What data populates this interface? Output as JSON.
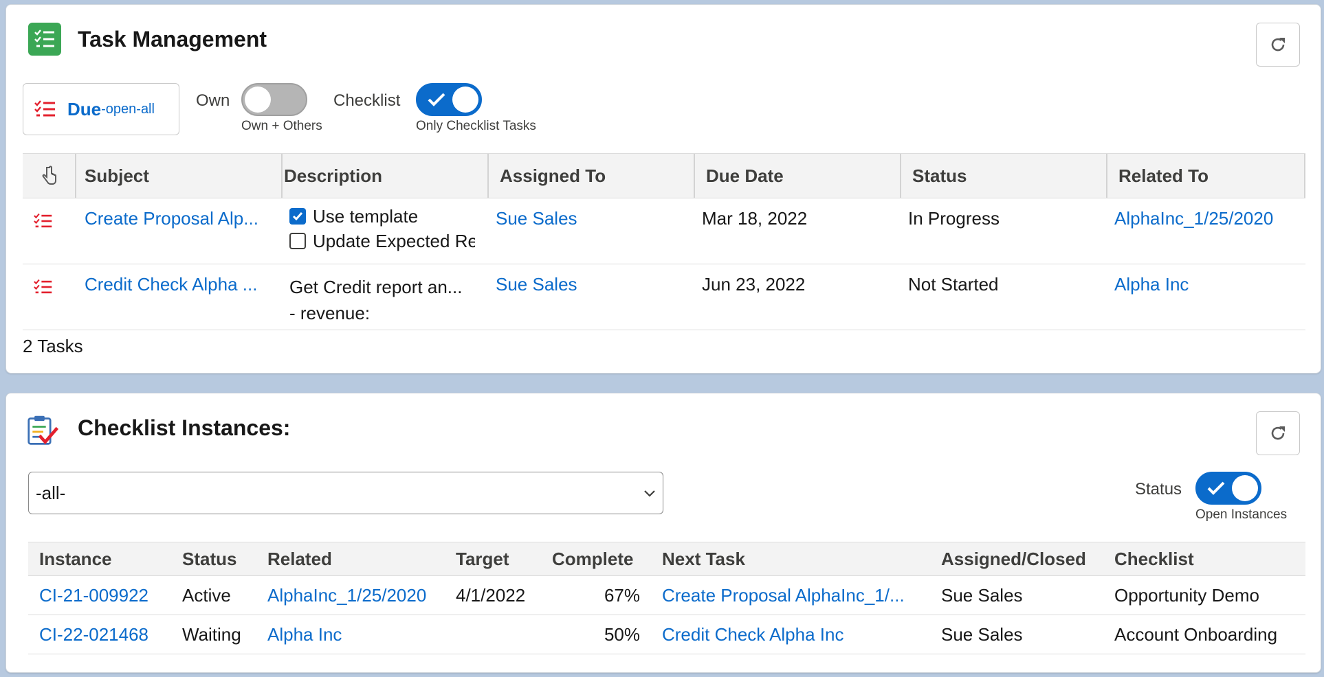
{
  "task_management": {
    "title": "Task Management",
    "due_button": {
      "main": "Due",
      "sub": "-open-all"
    },
    "own_toggle": {
      "label": "Own",
      "caption": "Own + Others",
      "on": false
    },
    "checklist_toggle": {
      "label": "Checklist",
      "caption": "Only Checklist Tasks",
      "on": true
    },
    "columns": [
      "Subject",
      "Description",
      "Assigned To",
      "Due Date",
      "Status",
      "Related To"
    ],
    "rows": [
      {
        "subject": "Create Proposal Alp...",
        "description_checks": [
          {
            "label": "Use template",
            "checked": true
          },
          {
            "label": "Update Expected Re",
            "checked": false
          }
        ],
        "assigned_to": "Sue Sales",
        "due_date": "Mar 18, 2022",
        "status": "In Progress",
        "related_to": "AlphaInc_1/25/2020"
      },
      {
        "subject": "Credit Check Alpha ...",
        "description_lines": [
          "Get Credit report an...",
          "- revenue:"
        ],
        "assigned_to": "Sue Sales",
        "due_date": "Jun 23, 2022",
        "status": "Not Started",
        "related_to": "Alpha Inc"
      }
    ],
    "count": "2 Tasks"
  },
  "checklist_instances": {
    "title": "Checklist Instances:",
    "filter_value": "-all-",
    "status_toggle": {
      "label": "Status",
      "caption": "Open Instances",
      "on": true
    },
    "columns": [
      "Instance",
      "Status",
      "Related",
      "Target",
      "Complete",
      "Next Task",
      "Assigned/Closed",
      "Checklist"
    ],
    "rows": [
      {
        "instance": "CI-21-009922",
        "status": "Active",
        "related": "AlphaInc_1/25/2020",
        "target": "4/1/2022",
        "complete": "67%",
        "next_task": "Create Proposal AlphaInc_1/...",
        "assigned_closed": "Sue Sales",
        "checklist": "Opportunity Demo"
      },
      {
        "instance": "CI-22-021468",
        "status": "Waiting",
        "related": "Alpha Inc",
        "target": "",
        "complete": "50%",
        "next_task": "Credit Check Alpha Inc",
        "assigned_closed": "Sue Sales",
        "checklist": "Account Onboarding"
      }
    ]
  },
  "icons": {
    "task_header": "task-list-icon",
    "checklist_header": "clipboard-check-icon",
    "refresh": "refresh-icon",
    "row_task": "red-task-list-icon",
    "column_action": "pointer-hand-icon",
    "dropdown": "chevron-down-icon"
  },
  "colors": {
    "link": "#0b6bcb",
    "task_icon_bg": "#3ba755",
    "toggle_on": "#0b6bcb",
    "toggle_off": "#b5b5b5",
    "red_task_icon": "#e3202d"
  }
}
